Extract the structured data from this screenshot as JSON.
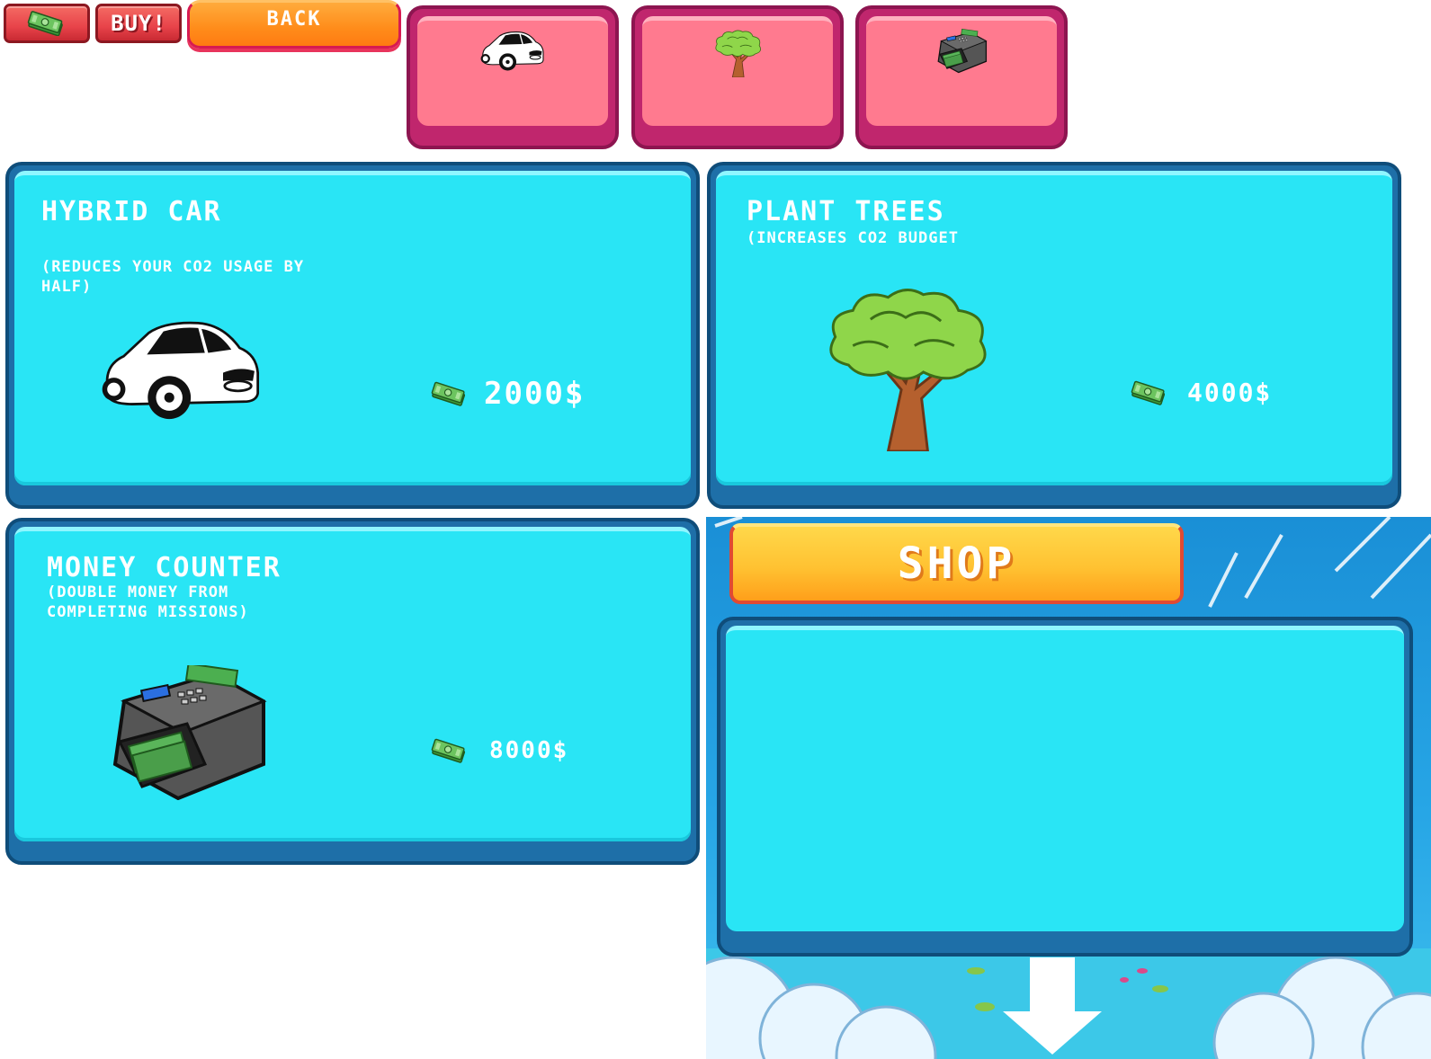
{
  "toolbar": {
    "buy_label": "BUY!",
    "back_label": "BACK",
    "money_icon": "money-icon"
  },
  "tabs": [
    {
      "name": "tab-car",
      "icon": "car-icon"
    },
    {
      "name": "tab-tree",
      "icon": "tree-icon"
    },
    {
      "name": "tab-money-counter",
      "icon": "money-counter-icon"
    }
  ],
  "items": [
    {
      "title": "HYBRID CAR",
      "desc_line1": "(REDUCES YOUR CO2 USAGE BY",
      "desc_line2": "HALF)",
      "price": "2000$",
      "icon": "car-icon"
    },
    {
      "title": "PLANT TREES",
      "desc_line1": "(INCREASES CO2 BUDGET",
      "desc_line2": "",
      "price": "4000$",
      "icon": "tree-icon"
    },
    {
      "title": "MONEY COUNTER",
      "desc_line1": "(DOUBLE MONEY FROM",
      "desc_line2": "COMPLETING MISSIONS)",
      "price": "8000$",
      "icon": "money-counter-icon"
    }
  ],
  "shop": {
    "title": "SHOP"
  },
  "colors": {
    "card_fill": "#29e5f5",
    "card_border": "#1e6fa8",
    "tab_fill": "#ff7a8f",
    "tab_border": "#c0266d",
    "buy_button": "#e8434a",
    "back_button": "#ff8c1a",
    "shop_button": "#ffc232"
  }
}
